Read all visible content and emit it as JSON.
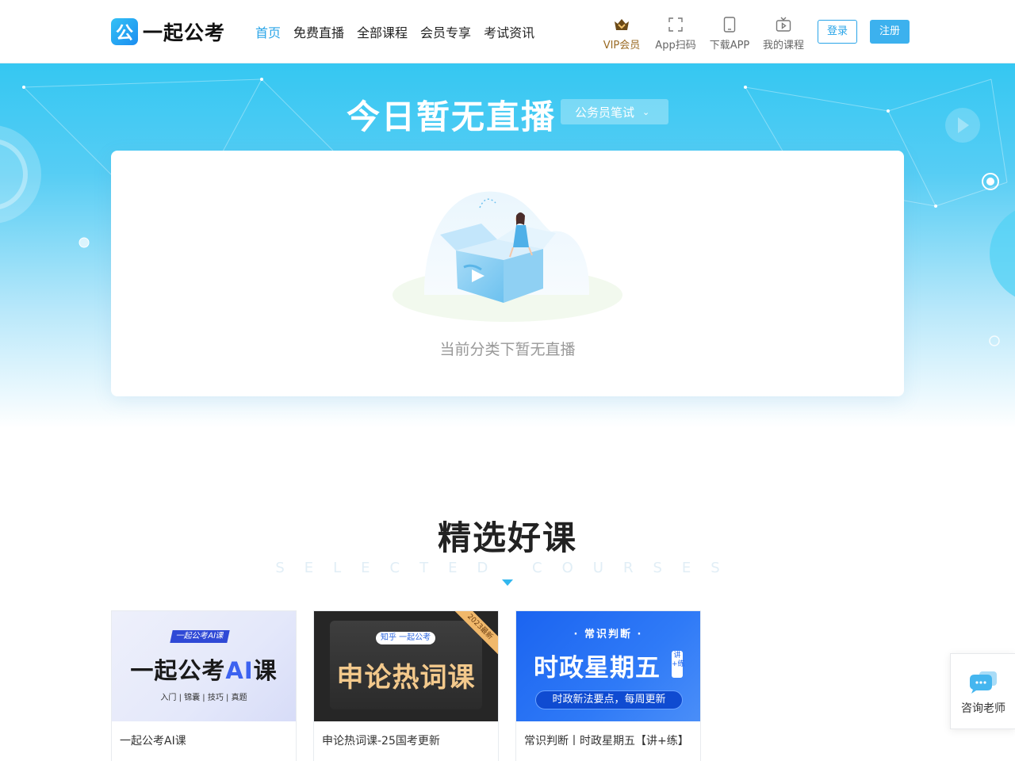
{
  "header": {
    "logo_mark": "公",
    "logo_text": "一起公考",
    "nav": [
      {
        "label": "首页",
        "active": true
      },
      {
        "label": "免费直播",
        "active": false
      },
      {
        "label": "全部课程",
        "active": false
      },
      {
        "label": "会员专享",
        "active": false
      },
      {
        "label": "考试资讯",
        "active": false
      }
    ],
    "tools": [
      {
        "label": "VIP会员",
        "icon": "crown-icon"
      },
      {
        "label": "App扫码",
        "icon": "scan-icon"
      },
      {
        "label": "下载APP",
        "icon": "phone-icon"
      },
      {
        "label": "我的课程",
        "icon": "video-icon"
      }
    ],
    "login_label": "登录",
    "register_label": "注册"
  },
  "hero": {
    "title": "今日暂无直播",
    "category": "公务员笔试",
    "empty_text": "当前分类下暂无直播"
  },
  "courses_section": {
    "title": "精选好课",
    "subtitle": "SELECTED COURSES",
    "items": [
      {
        "title": "一起公考AI课",
        "thumb_tag": "一起公考AI课",
        "thumb_main_prefix": "一起公考",
        "thumb_main_ai": "AI",
        "thumb_main_suffix": "课",
        "thumb_sub": "入门 | 锦囊 | 技巧 | 真题"
      },
      {
        "title": "申论热词课-25国考更新",
        "thumb_tag": "知乎 一起公考",
        "thumb_main": "申论热词课",
        "thumb_ribbon": "2023最新"
      },
      {
        "title": "常识判断丨时政星期五【讲+练】",
        "thumb_top": "· 常识判断 ·",
        "thumb_main": "时政星期五",
        "thumb_mini": "讲+练",
        "thumb_pill": "时政新法要点，每周更新"
      }
    ]
  },
  "consult": {
    "label": "咨询老师"
  },
  "colors": {
    "accent": "#2aa5e8",
    "vip": "#9a6a23",
    "hero_top": "#35c7f2"
  }
}
